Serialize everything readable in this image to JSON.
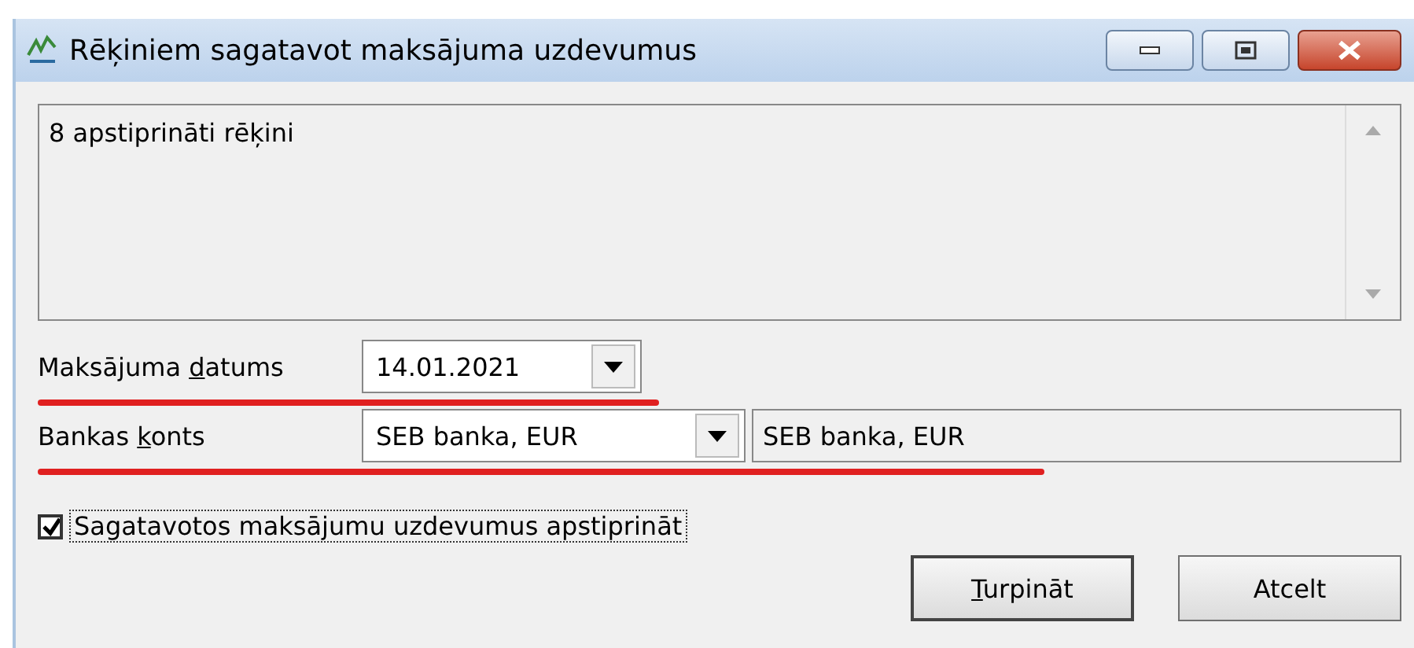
{
  "window": {
    "title": "Rēķiniem sagatavot maksājuma uzdevumus"
  },
  "info_box": {
    "text": "8 apstiprināti rēķini"
  },
  "fields": [
    {
      "label": {
        "before": "Maksājuma ",
        "accelerator": "d",
        "after": "atums"
      },
      "value": "14.01.2021",
      "underlined": true
    },
    {
      "label": {
        "before": "Bankas ",
        "accelerator": "k",
        "after": "onts"
      },
      "value": "SEB banka, EUR",
      "description": "SEB banka, EUR",
      "underlined": true
    }
  ],
  "checkbox": {
    "label": "Sagatavotos maksājumu uzdevumus apstiprināt",
    "checked": true
  },
  "buttons": [
    {
      "accelerator": "T",
      "after": "urpināt"
    },
    {
      "before": "Atcelt"
    }
  ]
}
